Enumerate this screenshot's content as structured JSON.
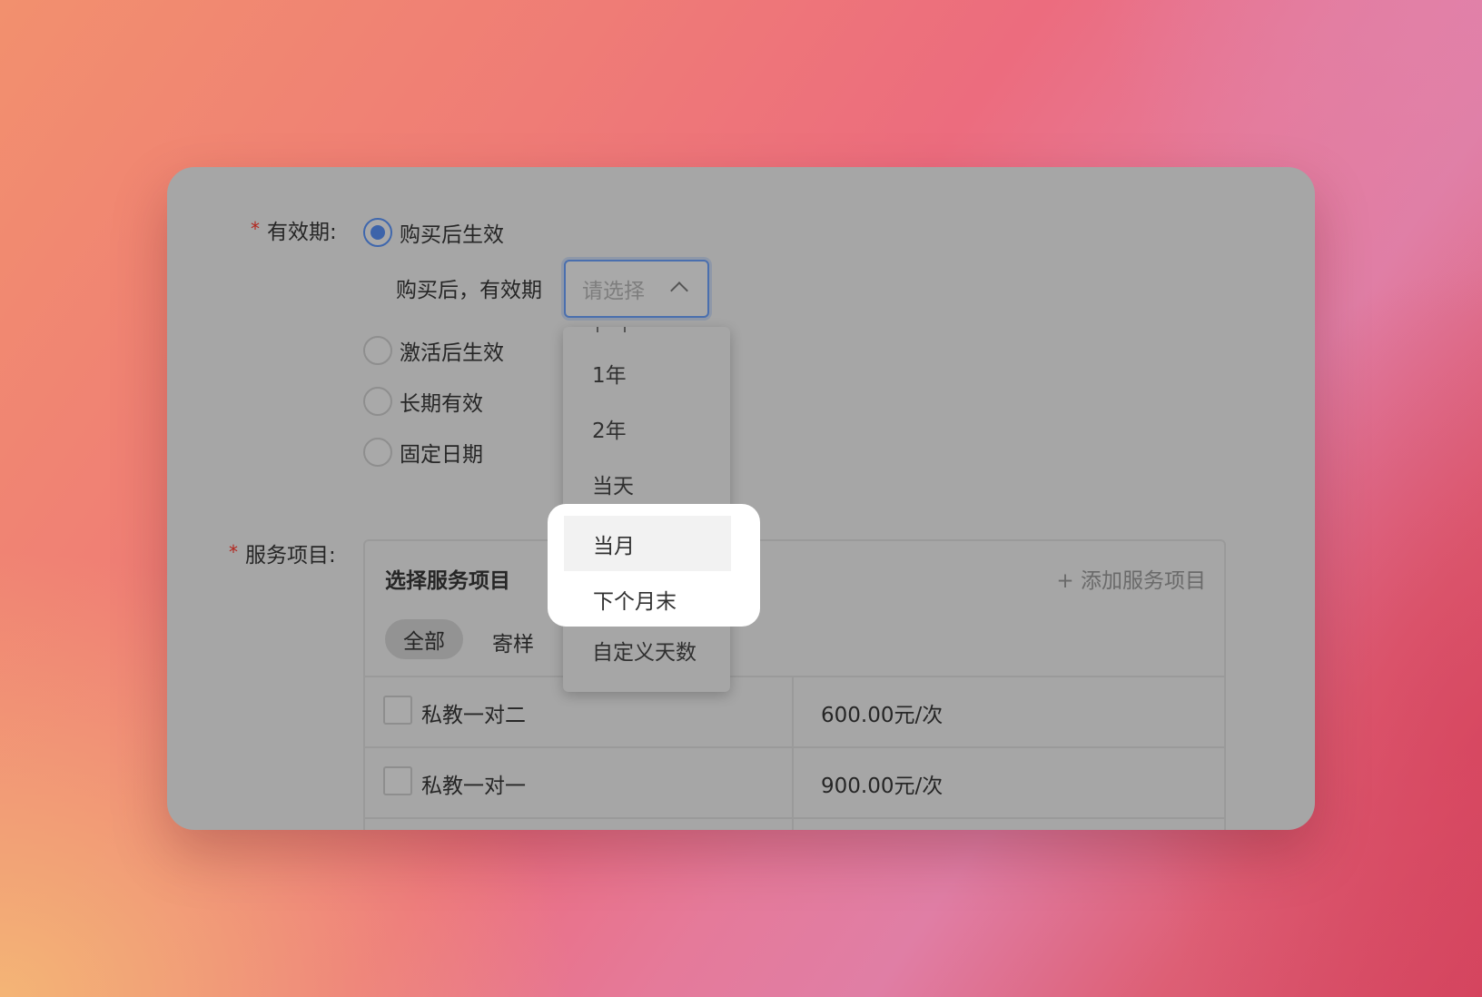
{
  "validity": {
    "label": "有效期:",
    "required_mark": "*",
    "options": [
      {
        "label": "购买后生效",
        "checked": true
      },
      {
        "label": "激活后生效",
        "checked": false
      },
      {
        "label": "长期有效",
        "checked": false
      },
      {
        "label": "固定日期",
        "checked": false
      }
    ],
    "sub_label": "购买后，有效期",
    "select_placeholder": "请选择",
    "dropdown_options": [
      "1年",
      "2年",
      "当天",
      "当月",
      "下个月末",
      "自定义天数"
    ],
    "hovered_option": "当月"
  },
  "services": {
    "label": "服务项目:",
    "required_mark": "*",
    "box_title": "选择服务项目",
    "add_link": "+ 添加服务项目",
    "tabs": [
      {
        "label": "全部",
        "active": true
      },
      {
        "label": "寄样",
        "active": false
      }
    ],
    "rows": [
      {
        "name": "私教一对二",
        "price": "600.00元/次"
      },
      {
        "name": "私教一对一",
        "price": "900.00元/次"
      }
    ]
  },
  "colors": {
    "accent": "#3d64aa",
    "required": "#b3261e",
    "overlay": "#a6a6a6"
  }
}
